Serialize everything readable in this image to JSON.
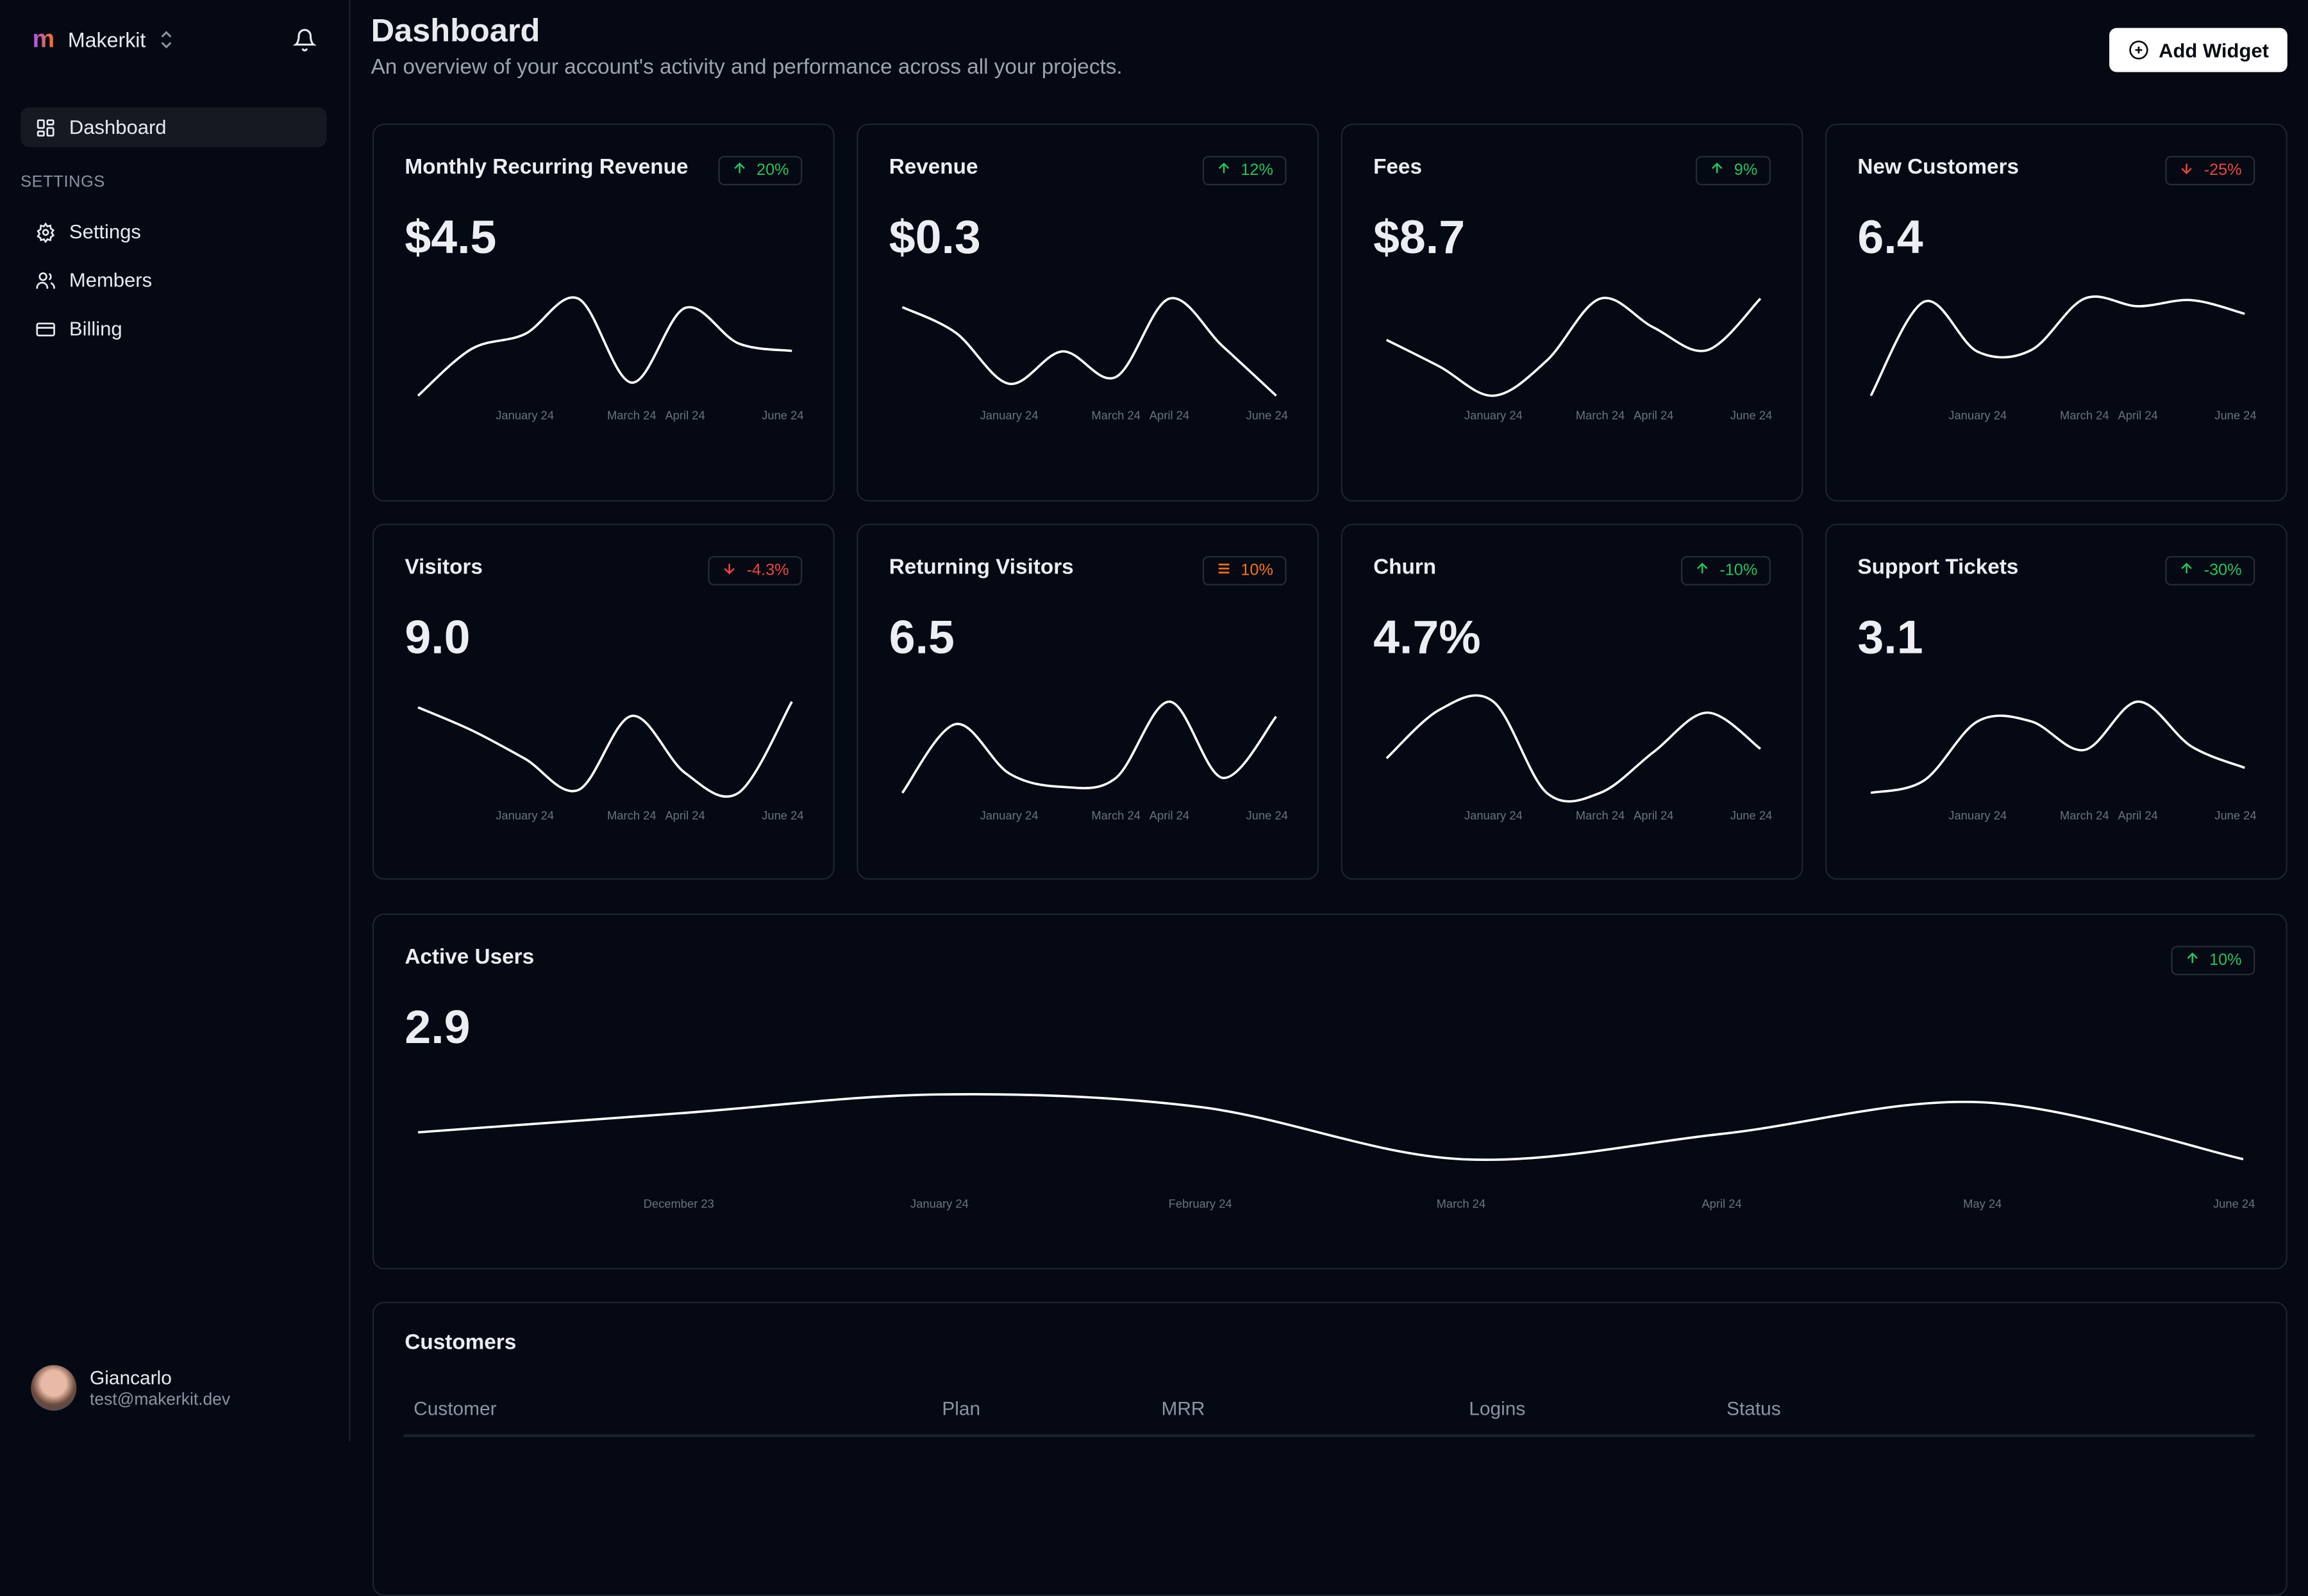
{
  "sidebar": {
    "brand": "Makerkit",
    "items": [
      {
        "label": "Dashboard",
        "icon": "dashboard-icon",
        "active": true
      }
    ],
    "section": "SETTINGS",
    "settings_items": [
      {
        "label": "Settings",
        "icon": "gear-icon"
      },
      {
        "label": "Members",
        "icon": "users-icon"
      },
      {
        "label": "Billing",
        "icon": "credit-card-icon"
      }
    ],
    "user": {
      "name": "Giancarlo",
      "email": "test@makerkit.dev"
    }
  },
  "header": {
    "title": "Dashboard",
    "subtitle": "An overview of your account's activity and performance across all your projects.",
    "add_widget": "Add Widget"
  },
  "colors": {
    "up": "#22c55e",
    "down": "#ef4444",
    "neutral": "#f97316",
    "line": "#ffffff"
  },
  "cards": [
    {
      "title": "Monthly Recurring Revenue",
      "value": "$4.5",
      "trend": "up",
      "change": "20%",
      "series": [
        15,
        40,
        48,
        67,
        22,
        62,
        43,
        39
      ]
    },
    {
      "title": "Revenue",
      "value": "$0.3",
      "trend": "up",
      "change": "12%",
      "series": [
        53,
        38,
        8,
        27,
        12,
        58,
        30,
        1
      ]
    },
    {
      "title": "Fees",
      "value": "$8.7",
      "trend": "up",
      "change": "9%",
      "series": [
        45,
        32,
        18,
        35,
        65,
        51,
        40,
        65
      ]
    },
    {
      "title": "New Customers",
      "value": "6.4",
      "trend": "down",
      "change": "-25%",
      "series": [
        16,
        78,
        45,
        46,
        80,
        75,
        79,
        70
      ]
    },
    {
      "title": "Visitors",
      "value": "9.0",
      "trend": "down",
      "change": "-4.3%",
      "series": [
        73,
        65,
        55,
        44,
        70,
        50,
        43,
        75
      ]
    },
    {
      "title": "Returning Visitors",
      "value": "6.5",
      "trend": "neutral",
      "change": "10%",
      "series": [
        28,
        74,
        41,
        32,
        38,
        89,
        38,
        79
      ]
    },
    {
      "title": "Churn",
      "value": "4.7%",
      "trend": "up",
      "change": "-10%",
      "series": [
        44,
        75,
        80,
        22,
        22,
        48,
        73,
        50
      ]
    },
    {
      "title": "Support Tickets",
      "value": "3.1",
      "trend": "up",
      "change": "-30%",
      "series": [
        26,
        33,
        66,
        66,
        50,
        77,
        52,
        40
      ]
    }
  ],
  "small_ticks": [
    {
      "index": 2,
      "label": "January 24"
    },
    {
      "index": 4,
      "label": "March 24"
    },
    {
      "index": 5,
      "label": "April 24"
    },
    {
      "index": 7,
      "label": "June 24"
    }
  ],
  "active_users": {
    "title": "Active Users",
    "value": "2.9",
    "trend": "up",
    "change": "10%",
    "series": [
      31,
      43,
      55,
      47,
      14,
      30,
      50,
      14
    ],
    "ticks": [
      {
        "index": 1,
        "label": "December 23"
      },
      {
        "index": 2,
        "label": "January 24"
      },
      {
        "index": 3,
        "label": "February 24"
      },
      {
        "index": 4,
        "label": "March 24"
      },
      {
        "index": 5,
        "label": "April 24"
      },
      {
        "index": 6,
        "label": "May 24"
      },
      {
        "index": 7,
        "label": "June 24"
      }
    ]
  },
  "customers": {
    "title": "Customers",
    "columns": [
      "Customer",
      "Plan",
      "MRR",
      "Logins",
      "Status"
    ]
  }
}
